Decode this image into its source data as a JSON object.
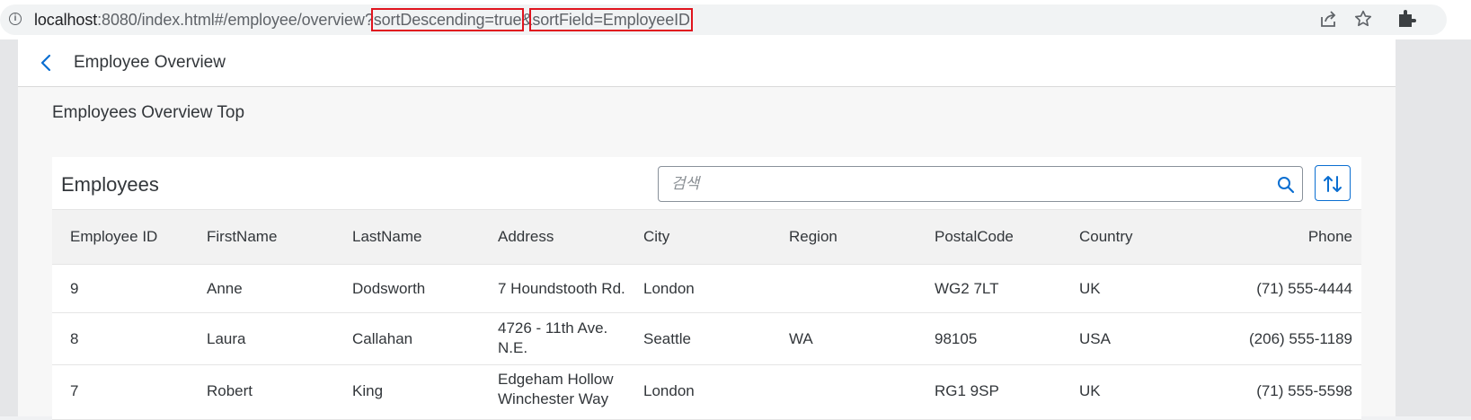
{
  "browser": {
    "url_host": "localhost",
    "url_path_before": ":8080/index.html#/employee/overview?",
    "url_param_1": "sortDescending=true",
    "url_separator": "&",
    "url_param_2": "sortField=EmployeeID"
  },
  "header": {
    "title": "Employee Overview"
  },
  "page": {
    "section_title": "Employees Overview Top"
  },
  "table": {
    "title": "Employees",
    "search_placeholder": "검색",
    "columns": [
      "Employee ID",
      "FirstName",
      "LastName",
      "Address",
      "City",
      "Region",
      "PostalCode",
      "Country",
      "Phone"
    ],
    "rows": [
      [
        "9",
        "Anne",
        "Dodsworth",
        "7 Houndstooth Rd.",
        "London",
        "",
        "WG2 7LT",
        "UK",
        "(71) 555-4444"
      ],
      [
        "8",
        "Laura",
        "Callahan",
        "4726 - 11th Ave. N.E.",
        "Seattle",
        "WA",
        "98105",
        "USA",
        "(206) 555-1189"
      ],
      [
        "7",
        "Robert",
        "King",
        "Edgeham Hollow Winchester Way",
        "London",
        "",
        "RG1 9SP",
        "UK",
        "(71) 555-5598"
      ]
    ]
  },
  "colors": {
    "accent": "#0a6ed1",
    "highlight": "#e0141e"
  },
  "icons": {
    "info": "info-icon",
    "share": "share-icon",
    "star": "star-icon",
    "extensions": "puzzle-icon",
    "back": "chevron-left-icon",
    "search": "search-icon",
    "sort": "sort-icon"
  }
}
